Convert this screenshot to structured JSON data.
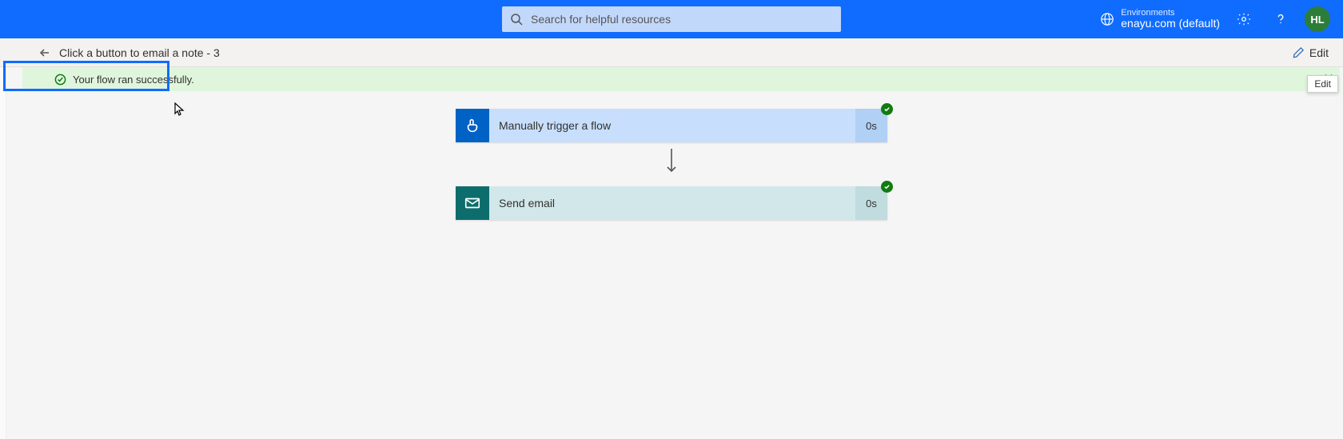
{
  "header": {
    "search_placeholder": "Search for helpful resources",
    "environments_label": "Environments",
    "environment_name": "enayu.com (default)",
    "avatar_initials": "HL"
  },
  "breadcrumb": {
    "title": "Click a button to email a note - 3",
    "edit_label": "Edit"
  },
  "banner": {
    "message": "Your flow ran successfully."
  },
  "tooltip": {
    "edit": "Edit"
  },
  "flow": {
    "steps": [
      {
        "kind": "trigger",
        "label": "Manually trigger a flow",
        "duration": "0s",
        "status": "success"
      },
      {
        "kind": "action",
        "label": "Send email",
        "duration": "0s",
        "status": "success"
      }
    ]
  },
  "colors": {
    "brand_blue": "#0f6cff",
    "success_green": "#107c10",
    "banner_green": "#dff6dd"
  }
}
